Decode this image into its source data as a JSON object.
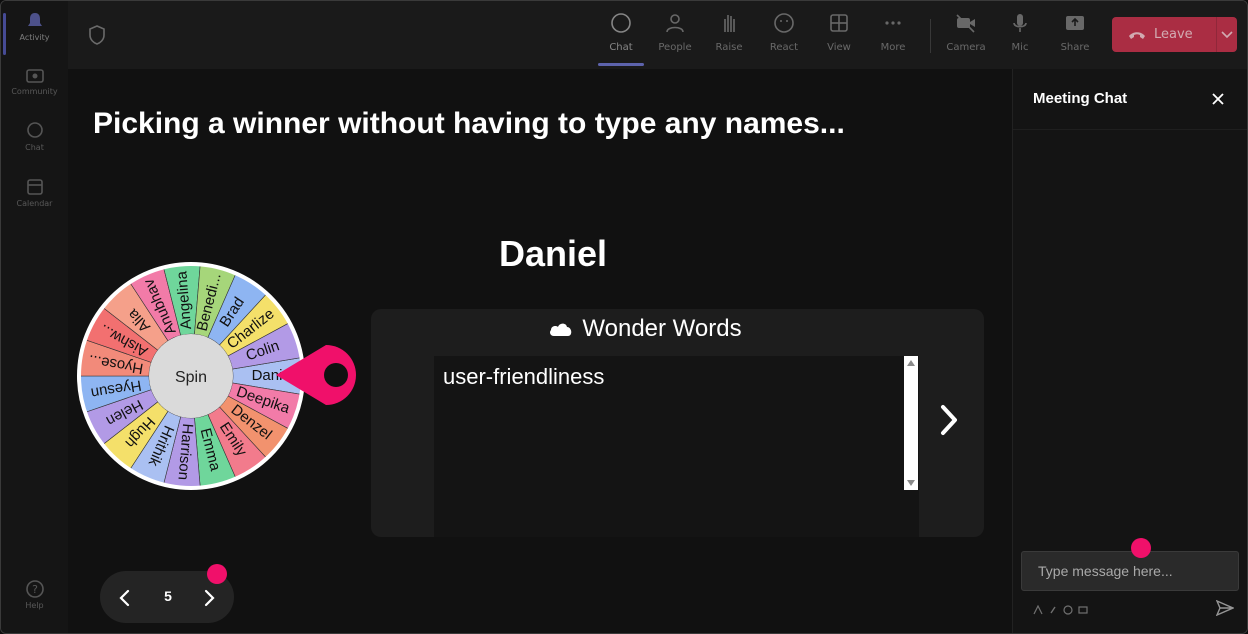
{
  "rail": {
    "items": [
      {
        "label": "Activity",
        "icon": "bell-icon"
      },
      {
        "label": "Community",
        "icon": "community-icon"
      },
      {
        "label": "Chat",
        "icon": "chat-icon"
      },
      {
        "label": "Calendar",
        "icon": "calendar-icon"
      }
    ],
    "help": {
      "label": "Help",
      "icon": "help-icon"
    }
  },
  "toolbar": {
    "chat": "Chat",
    "people": "People",
    "raise": "Raise",
    "react": "React",
    "view": "View",
    "more": "More",
    "camera": "Camera",
    "mic": "Mic",
    "share": "Share",
    "leave": "Leave"
  },
  "stage": {
    "headline": "Picking a winner without having to type any names...",
    "winner": "Daniel",
    "wheel": {
      "center_label": "Spin",
      "names": [
        "Dani",
        "Deepika",
        "Denzel",
        "Emily",
        "Emma",
        "Harrison",
        "Hrithik",
        "Hugh",
        "Helen",
        "Hyesun",
        "Hyose...",
        "Aishw...",
        "Alia",
        "Anubhav",
        "Angelina",
        "Benedi...",
        "Brad",
        "Charlize",
        "Colin"
      ],
      "colors": [
        "#aac0f2",
        "#f27ba8",
        "#f2926e",
        "#f27b8c",
        "#6fd69b",
        "#b29ae6",
        "#aac0f2",
        "#f4e06a",
        "#b29ae6",
        "#8eb5f2",
        "#f28a7a",
        "#f27070",
        "#f5a08a",
        "#f27ba8",
        "#6fd69b",
        "#a6d67a",
        "#8eb5f2",
        "#f4e06a",
        "#b29ae6"
      ]
    },
    "wonder_words": {
      "title": "Wonder Words",
      "word": "user-friendliness"
    },
    "pager": {
      "page": "5"
    }
  },
  "chat": {
    "title": "Meeting Chat",
    "placeholder": "Type message here..."
  },
  "colors": {
    "accent": "#7b83eb",
    "leave": "#c4314b",
    "pink": "#f0106a"
  }
}
